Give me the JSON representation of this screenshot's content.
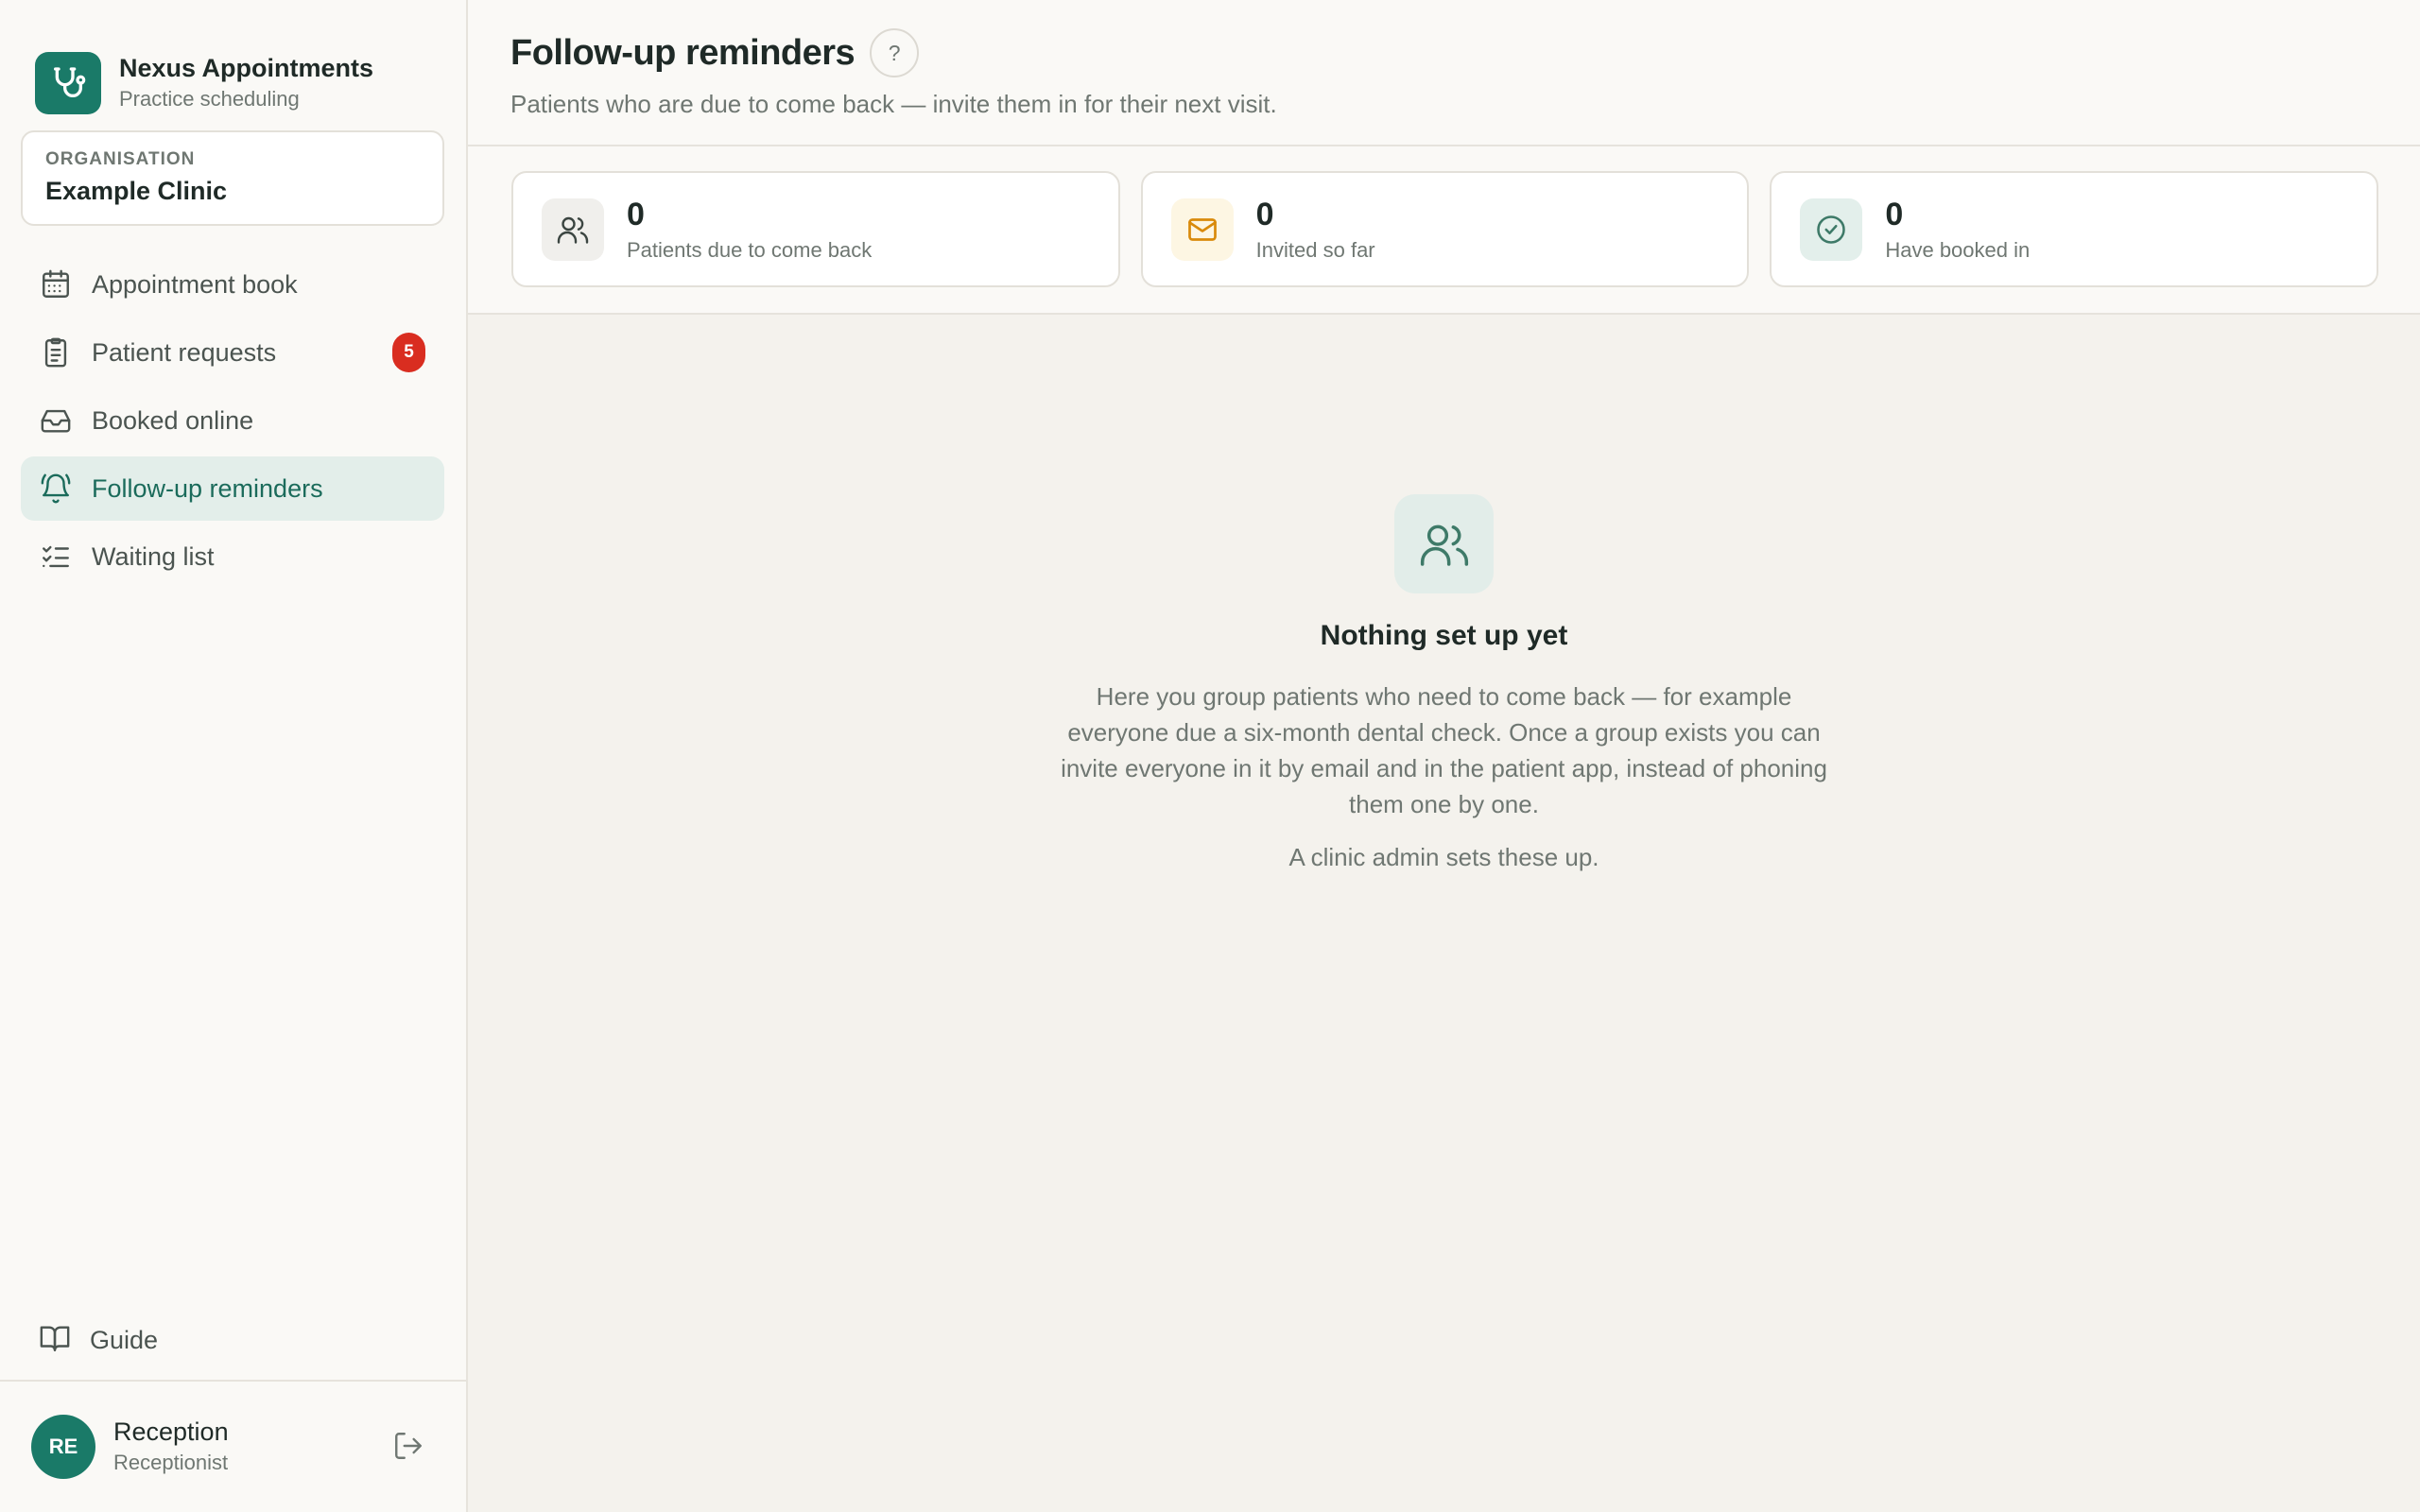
{
  "brand": {
    "name": "Nexus Appointments",
    "subtitle": "Practice scheduling"
  },
  "organisation": {
    "label": "Organisation",
    "name": "Example Clinic"
  },
  "nav": [
    {
      "label": "Appointment book",
      "icon": "calendar-icon",
      "active": false
    },
    {
      "label": "Patient requests",
      "icon": "clipboard-icon",
      "badge": "5",
      "active": false
    },
    {
      "label": "Booked online",
      "icon": "inbox-icon",
      "active": false
    },
    {
      "label": "Follow-up reminders",
      "icon": "bell-ring-icon",
      "active": true
    },
    {
      "label": "Waiting list",
      "icon": "list-checks-icon",
      "active": false
    }
  ],
  "guide": {
    "label": "Guide",
    "icon": "book-open-icon"
  },
  "user": {
    "initials": "RE",
    "name": "Reception",
    "role": "Receptionist"
  },
  "header": {
    "title": "Follow-up reminders",
    "help": "?",
    "subtitle": "Patients who are due to come back — invite them in for their next visit."
  },
  "stats": [
    {
      "value": "0",
      "label": "Patients due to come back",
      "icon": "users-icon"
    },
    {
      "value": "0",
      "label": "Invited so far",
      "icon": "mail-icon"
    },
    {
      "value": "0",
      "label": "Have booked in",
      "icon": "check-circle-icon"
    }
  ],
  "empty_state": {
    "title": "Nothing set up yet",
    "body": "Here you group patients who need to come back — for example everyone due a six-month dental check. Once a group exists you can invite everyone in it by email and in the patient app, instead of phoning them one by one.",
    "note": "A clinic admin sets these up."
  },
  "colors": {
    "brand": "#1a7a68",
    "active_nav_bg": "#e3eeea",
    "badge": "#d92d20",
    "amber_icon": "#d98a0b"
  }
}
